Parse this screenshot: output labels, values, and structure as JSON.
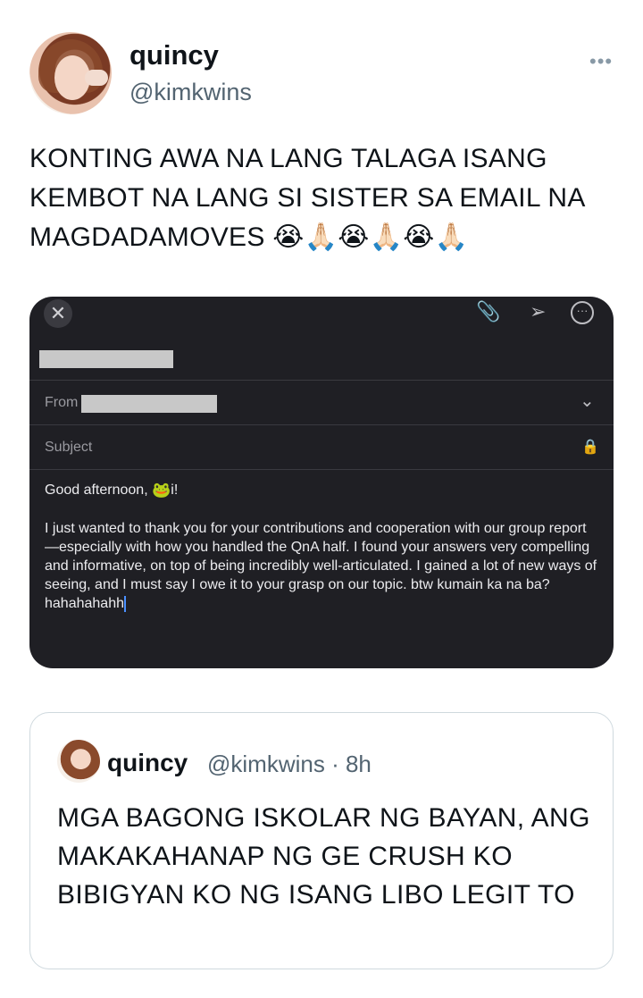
{
  "tweet": {
    "display_name": "quincy",
    "handle": "@kimkwins",
    "more_icon": "•••",
    "text": "KONTING AWA NA LANG TALAGA ISANG KEMBOT NA LANG SI SISTER SA EMAIL NA MAGDADAMOVES 😭🙏🏻😭🙏🏻😭🙏🏻"
  },
  "email": {
    "close_icon": "✕",
    "attach_icon": "📎",
    "send_icon": "➢",
    "more_icon": "···",
    "from_label": "From",
    "subject_placeholder": "Subject",
    "chevron_icon": "⌄",
    "lock_icon": "🔒",
    "greeting": "Good afternoon,",
    "greeting_suffix": "i!",
    "frog": "🐸",
    "body": "I just wanted to thank you for your contributions and cooperation with our group report—especially with how you handled the QnA half. I found your answers very compelling and informative, on top of being incredibly well-articulated. I gained a lot of new ways of seeing, and I must say I owe it to your grasp on our topic. btw kumain ka na ba? hahahahahh"
  },
  "quote": {
    "display_name": "quincy",
    "meta": "@kimkwins · 8h",
    "text": "MGA BAGONG ISKOLAR NG BAYAN, ANG MAKAKAHANAP NG GE CRUSH KO BIBIGYAN KO NG ISANG LIBO LEGIT TO"
  }
}
